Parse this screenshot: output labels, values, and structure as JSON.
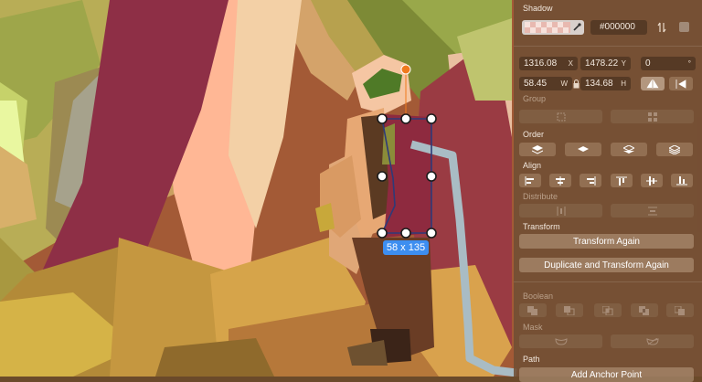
{
  "selection": {
    "size_label": "58 x 135"
  },
  "panel": {
    "shadow": {
      "title": "Shadow",
      "color_hex": "#000000"
    },
    "geometry": {
      "x": "1316.08",
      "x_unit": "X",
      "y": "1478.22",
      "y_unit": "Y",
      "rotation": "0",
      "rotation_unit": "°",
      "width": "58.45",
      "width_unit": "W",
      "height": "134.68",
      "height_unit": "H"
    },
    "group": {
      "title": "Group"
    },
    "order": {
      "title": "Order"
    },
    "align": {
      "title": "Align"
    },
    "distribute": {
      "title": "Distribute"
    },
    "transform": {
      "title": "Transform",
      "again_label": "Transform Again",
      "duplicate_label": "Duplicate and Transform Again"
    },
    "boolean": {
      "title": "Boolean"
    },
    "mask": {
      "title": "Mask"
    },
    "path": {
      "title": "Path",
      "button_label": "Add Anchor Point"
    }
  },
  "colors": {
    "accent_blue": "#3d8ef0",
    "rotation_handle": "#f07a1e",
    "path_stroke": "#a9bcc4"
  }
}
